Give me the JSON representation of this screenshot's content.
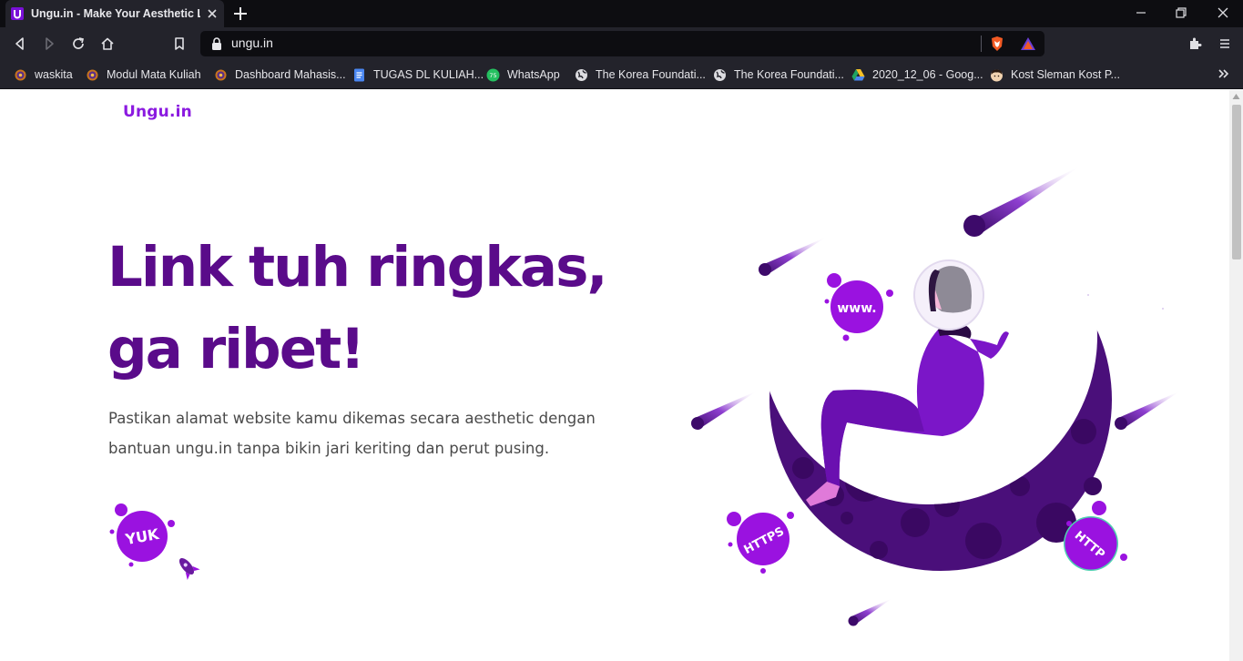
{
  "browser": {
    "tab_title": "Ungu.in - Make Your Aesthetic Link",
    "url": "ungu.in",
    "bookmarks": [
      {
        "label": "waskita",
        "icon": "gear-icon"
      },
      {
        "label": "Modul Mata Kuliah",
        "icon": "gear-icon"
      },
      {
        "label": "Dashboard Mahasis...",
        "icon": "gear-icon"
      },
      {
        "label": "TUGAS DL KULIAH...",
        "icon": "docs-icon"
      },
      {
        "label": "WhatsApp",
        "icon": "whatsapp-icon"
      },
      {
        "label": "The Korea Foundati...",
        "icon": "globe-icon"
      },
      {
        "label": "The Korea Foundati...",
        "icon": "globe-icon"
      },
      {
        "label": "2020_12_06 - Goog...",
        "icon": "google-drive-icon"
      },
      {
        "label": "Kost Sleman Kost P...",
        "icon": "avatar-icon"
      }
    ],
    "whatsapp_badge": "75"
  },
  "page": {
    "logo": "Ungu.in",
    "headline_line1": "Link tuh ringkas,",
    "headline_line2": "ga ribet!",
    "subtext": "Pastikan alamat website kamu dikemas secara aesthetic dengan bantuan ungu.in tanpa bikin jari keriting dan perut pusing.",
    "cta_label": "YUK",
    "bubbles": {
      "www": "www.",
      "https": "HTTPS",
      "http": "HTTP"
    }
  },
  "colors": {
    "brand": "#8b1ae0",
    "headline": "#5a0b8a",
    "moon": "#4a0f7a",
    "bubble": "#9a12e0"
  }
}
